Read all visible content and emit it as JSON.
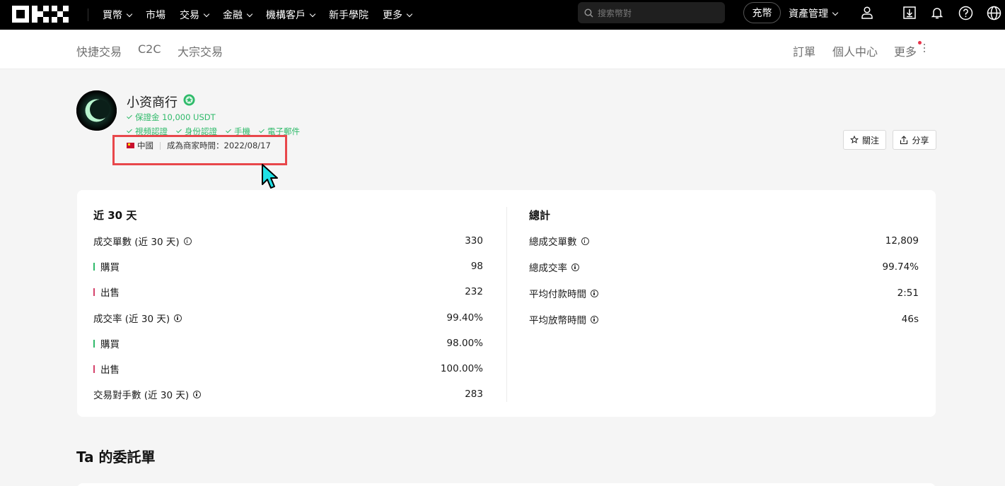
{
  "topnav": {
    "items": [
      {
        "label": "買幣",
        "dropdown": true
      },
      {
        "label": "市場",
        "dropdown": false
      },
      {
        "label": "交易",
        "dropdown": true
      },
      {
        "label": "金融",
        "dropdown": true
      },
      {
        "label": "機構客戶",
        "dropdown": true
      },
      {
        "label": "新手學院",
        "dropdown": false
      },
      {
        "label": "更多",
        "dropdown": true
      }
    ],
    "search_placeholder": "搜索幣對",
    "deposit_label": "充幣",
    "asset_label": "資產管理",
    "icons": [
      "user-icon",
      "download-icon",
      "bell-icon",
      "help-icon",
      "globe-icon"
    ]
  },
  "subnav": {
    "left": [
      "快捷交易",
      "C2C",
      "大宗交易"
    ],
    "right": [
      "訂單",
      "個人中心",
      "更多"
    ]
  },
  "profile": {
    "name": "小资商行",
    "deposit": "保證金 10,000 USDT",
    "verifications": [
      "視頻認證",
      "身份認證",
      "手機",
      "電子郵件"
    ],
    "country": "中國",
    "since": "成為商家時間：2022/08/17",
    "follow_label": "關注",
    "share_label": "分享"
  },
  "stats30": {
    "title": "近 30 天",
    "rows": [
      {
        "label": "成交單數 (近 30 天)",
        "value": "330"
      },
      {
        "label": "購買",
        "value": "98"
      },
      {
        "label": "出售",
        "value": "232"
      },
      {
        "label": "成交率 (近 30 天)",
        "value": "99.40%"
      },
      {
        "label": "購買",
        "value": "98.00%"
      },
      {
        "label": "出售",
        "value": "100.00%"
      },
      {
        "label": "交易對手數 (近 30 天)",
        "value": "283"
      }
    ]
  },
  "total": {
    "title": "總計",
    "rows": [
      {
        "label": "總成交單數",
        "value": "12,809"
      },
      {
        "label": "總成交率",
        "value": "99.74%"
      },
      {
        "label": "平均付款時間",
        "value": "2:51"
      },
      {
        "label": "平均放幣時間",
        "value": "46s"
      }
    ]
  },
  "orders_title": "Ta 的委託單",
  "colors": {
    "accent_green": "#2fba6a",
    "sell_red": "#d5426b",
    "highlight": "#e8474b",
    "cursor": "#1fe0e6"
  }
}
